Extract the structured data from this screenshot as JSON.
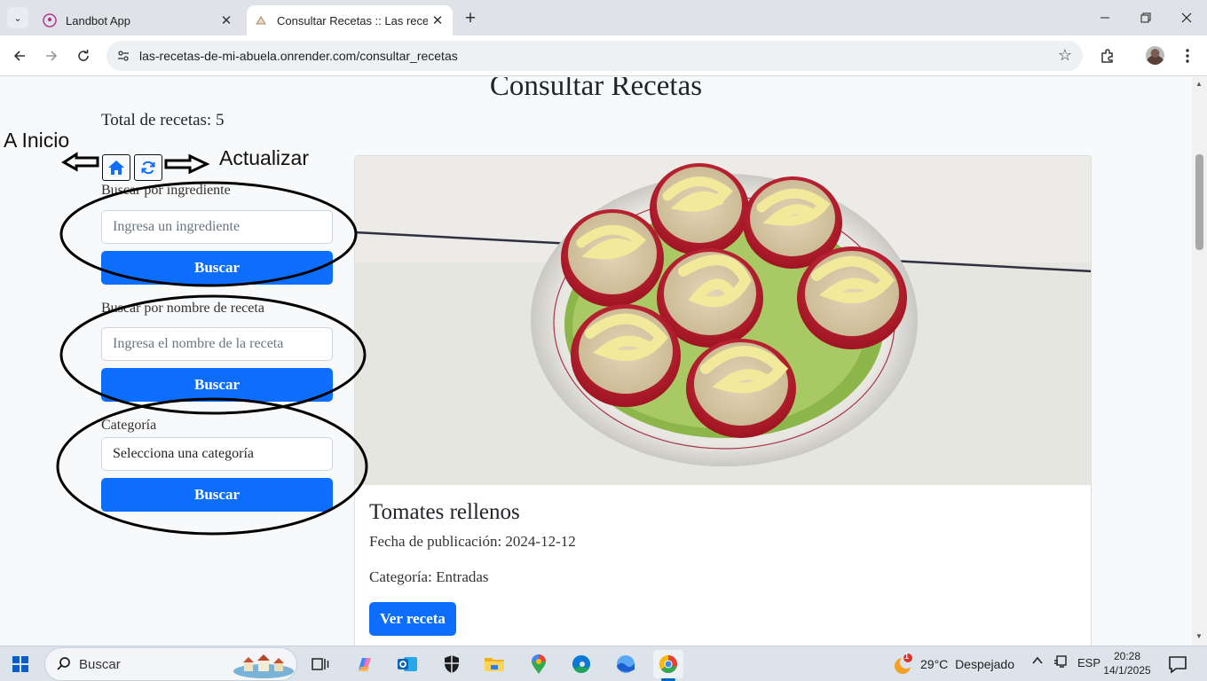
{
  "browser": {
    "tabs": [
      {
        "title": "Landbot App",
        "active": false
      },
      {
        "title": "Consultar Recetas :: Las recetas",
        "active": true
      }
    ],
    "url": "las-recetas-de-mi-abuela.onrender.com/consultar_recetas"
  },
  "page": {
    "title": "Consultar Recetas",
    "total_label": "Total de recetas:",
    "total_value": "5",
    "search_ingredient": {
      "label": "Buscar por ingrediente",
      "placeholder": "Ingresa un ingrediente",
      "button": "Buscar"
    },
    "search_name": {
      "label": "Buscar por nombre de receta",
      "placeholder": "Ingresa el nombre de la receta",
      "button": "Buscar"
    },
    "category": {
      "label": "Categoría",
      "selected": "Selecciona una categoría",
      "button": "Buscar"
    },
    "annotations": {
      "home": "A Inicio",
      "refresh": "Actualizar"
    },
    "recipe_card": {
      "title": "Tomates rellenos",
      "date_label": "Fecha de publicación:",
      "date_value": "2024-12-12",
      "category_label": "Categoría:",
      "category_value": "Entradas",
      "button": "Ver receta"
    }
  },
  "taskbar": {
    "search_placeholder": "Buscar",
    "weather_temp": "29°C",
    "weather_desc": "Despejado",
    "weather_badge": "1",
    "language": "ESP",
    "time": "20:28",
    "date": "14/1/2025"
  },
  "colors": {
    "primary": "#0d6efd",
    "page_bg": "#f8f9fa",
    "annotation": "#000000"
  }
}
